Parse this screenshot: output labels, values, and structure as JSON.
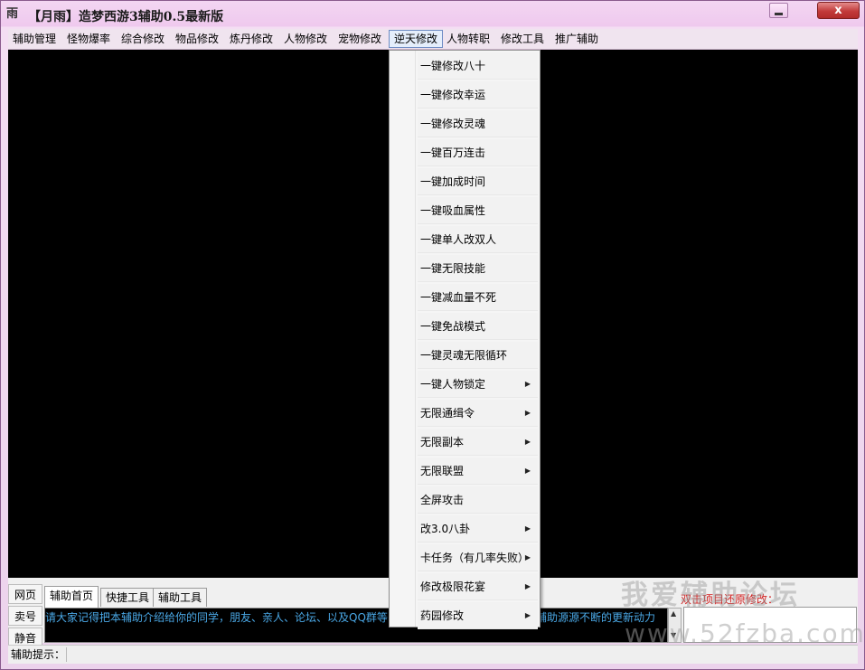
{
  "window": {
    "icon_char": "雨",
    "title": "【月雨】造梦西游3辅助0.5最新版",
    "close_glyph": "x"
  },
  "menubar": [
    {
      "label": "辅助管理",
      "active": false
    },
    {
      "label": "怪物爆率",
      "active": false
    },
    {
      "label": "综合修改",
      "active": false
    },
    {
      "label": "物品修改",
      "active": false
    },
    {
      "label": "炼丹修改",
      "active": false
    },
    {
      "label": "人物修改",
      "active": false
    },
    {
      "label": "宠物修改",
      "active": false
    },
    {
      "label": "逆天修改",
      "active": true
    },
    {
      "label": "人物转职",
      "active": false
    },
    {
      "label": "修改工具",
      "active": false
    },
    {
      "label": "推广辅助",
      "active": false
    }
  ],
  "dropdown": [
    {
      "label": "一键修改八十",
      "submenu": false
    },
    {
      "label": "一键修改幸运",
      "submenu": false
    },
    {
      "label": "一键修改灵魂",
      "submenu": false
    },
    {
      "label": "一键百万连击",
      "submenu": false
    },
    {
      "label": "一键加成时间",
      "submenu": false
    },
    {
      "label": "一键吸血属性",
      "submenu": false
    },
    {
      "label": "一键单人改双人",
      "submenu": false
    },
    {
      "label": "一键无限技能",
      "submenu": false
    },
    {
      "label": "一键减血量不死",
      "submenu": false
    },
    {
      "label": "一键免战模式",
      "submenu": false
    },
    {
      "label": "一键灵魂无限循环",
      "submenu": false
    },
    {
      "label": "一键人物锁定",
      "submenu": true
    },
    {
      "label": "无限通缉令",
      "submenu": true
    },
    {
      "label": "无限副本",
      "submenu": true
    },
    {
      "label": "无限联盟",
      "submenu": true
    },
    {
      "label": "全屏攻击",
      "submenu": false
    },
    {
      "label": "改3.0八卦",
      "submenu": true
    },
    {
      "label": "卡任务（有几率失败）",
      "submenu": true
    },
    {
      "label": "修改极限花宴",
      "submenu": true
    },
    {
      "label": "药园修改",
      "submenu": true
    }
  ],
  "side_tabs": [
    "网页",
    "卖号",
    "静音"
  ],
  "bottom_tabs": [
    {
      "label": "辅助首页",
      "active": true
    },
    {
      "label": "快捷工具",
      "active": false
    },
    {
      "label": "辅助工具",
      "active": false
    }
  ],
  "info_text": "请大家记得把本辅助介绍给你的同学，朋友、亲人、论坛、以及QQ群等，",
  "info_text_tail": "辅助源源不断的更新动力",
  "restore_label": "双击项目还原修改：",
  "status_label": "辅助提示：",
  "watermark": {
    "line1": "我爱辅助论坛",
    "line2": "www.52fzba.com"
  },
  "colors": {
    "restore_label": "#d21f1f",
    "info_text": "#4aa8e6",
    "close_button": "#c23b3b"
  }
}
